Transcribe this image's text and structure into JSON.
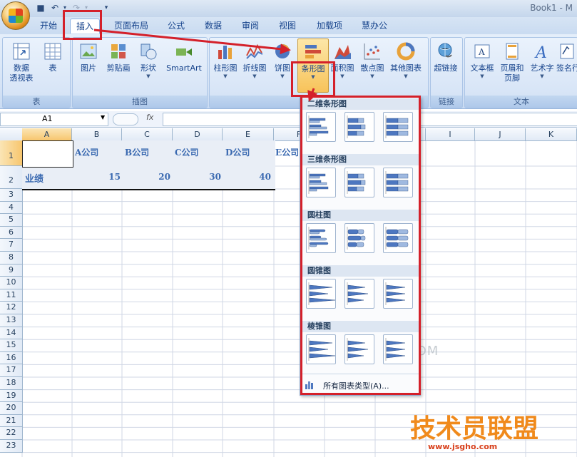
{
  "window": {
    "title": "Book1 - M"
  },
  "tabs": [
    "开始",
    "插入",
    "页面布局",
    "公式",
    "数据",
    "审阅",
    "视图",
    "加载项",
    "慧办公"
  ],
  "ribbon": {
    "table_group": {
      "label": "表",
      "pivot": "数据\n透视表",
      "pivot_line1": "数据",
      "pivot_line2": "透视表",
      "table": "表"
    },
    "illustrations_group": {
      "label": "插图",
      "picture": "图片",
      "clipart": "剪贴画",
      "shapes": "形状",
      "smartart": "SmartArt"
    },
    "charts_group": {
      "label": "图表",
      "column": "柱形图",
      "line": "折线图",
      "pie": "饼图",
      "bar": "条形图",
      "area": "面积图",
      "scatter": "散点图",
      "other": "其他图表"
    },
    "links_group": {
      "label": "链接",
      "hyperlink": "超链接"
    },
    "text_group": {
      "label": "文本",
      "textbox": "文本框",
      "header_line1": "页眉和",
      "header_line2": "页脚",
      "wordart": "艺术字",
      "signature": "签名行"
    }
  },
  "formula_bar": {
    "namebox": "A1",
    "fx": "fx"
  },
  "columns": [
    "A",
    "B",
    "C",
    "D",
    "E",
    "F",
    "G",
    "H",
    "I",
    "J",
    "K"
  ],
  "rows": [
    "1",
    "2",
    "3",
    "4",
    "5",
    "6",
    "7",
    "8",
    "9",
    "10",
    "11",
    "12",
    "13",
    "14",
    "15",
    "16",
    "17",
    "18",
    "19",
    "20",
    "21",
    "22",
    "23"
  ],
  "sheet": {
    "headers": [
      "A公司",
      "B公司",
      "C公司",
      "D公司",
      "E公司"
    ],
    "row_label": "业绩",
    "values": [
      "15",
      "20",
      "30",
      "40"
    ]
  },
  "dropdown": {
    "sections": [
      "二维条形图",
      "三维条形图",
      "圆柱图",
      "圆锥图",
      "棱锥图"
    ],
    "all_types": "所有图表类型(A)..."
  },
  "watermark": "联 3LIAN.COM",
  "brand": {
    "name": "技术员联盟",
    "url": "www.jsgho.com"
  },
  "colors": {
    "highlight": "#d4202a",
    "accent": "#15428b",
    "data_text": "#3b6ab1"
  }
}
